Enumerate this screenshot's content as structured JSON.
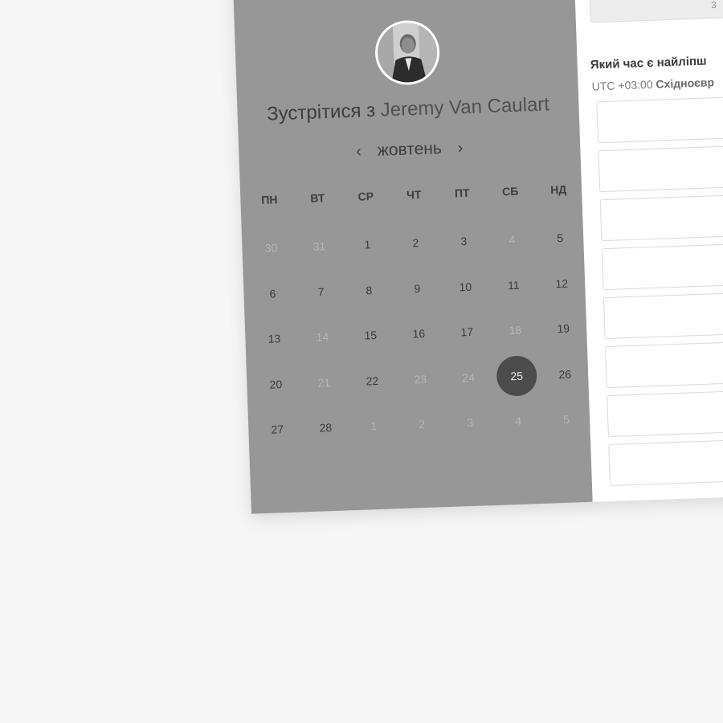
{
  "meet": {
    "prefix": "Зустрітися з",
    "host": "Jeremy Van Caulart"
  },
  "calendar": {
    "month": "жовтень",
    "prev_icon": "‹",
    "next_icon": "›",
    "weekdays": [
      "ПН",
      "ВТ",
      "СР",
      "ЧТ",
      "ПТ",
      "СБ",
      "НД"
    ],
    "weeks": [
      [
        {
          "d": "30",
          "m": true
        },
        {
          "d": "31",
          "m": true
        },
        {
          "d": "1"
        },
        {
          "d": "2"
        },
        {
          "d": "3"
        },
        {
          "d": "4",
          "m": true
        },
        {
          "d": "5"
        }
      ],
      [
        {
          "d": "6"
        },
        {
          "d": "7"
        },
        {
          "d": "8"
        },
        {
          "d": "9"
        },
        {
          "d": "10"
        },
        {
          "d": "11"
        },
        {
          "d": "12"
        }
      ],
      [
        {
          "d": "13"
        },
        {
          "d": "14",
          "m": true
        },
        {
          "d": "15"
        },
        {
          "d": "16"
        },
        {
          "d": "17"
        },
        {
          "d": "18",
          "m": true
        },
        {
          "d": "19"
        }
      ],
      [
        {
          "d": "20"
        },
        {
          "d": "21",
          "m": true
        },
        {
          "d": "22"
        },
        {
          "d": "23",
          "m": true
        },
        {
          "d": "24",
          "m": true
        },
        {
          "d": "25",
          "selected": true
        },
        {
          "d": "26"
        }
      ],
      [
        {
          "d": "27"
        },
        {
          "d": "28"
        },
        {
          "d": "1",
          "m": true
        },
        {
          "d": "2",
          "m": true
        },
        {
          "d": "3",
          "m": true
        },
        {
          "d": "4",
          "m": true
        },
        {
          "d": "5",
          "m": true
        }
      ]
    ]
  },
  "right": {
    "top_box_text": "3",
    "question": "Який час є найліпш",
    "tz_offset": "UTC +03:00",
    "tz_name": "Східноєвр"
  },
  "colors": {
    "panel": "#979797",
    "selected_day": "#4c4c4c",
    "background": "#f6f6f6"
  }
}
